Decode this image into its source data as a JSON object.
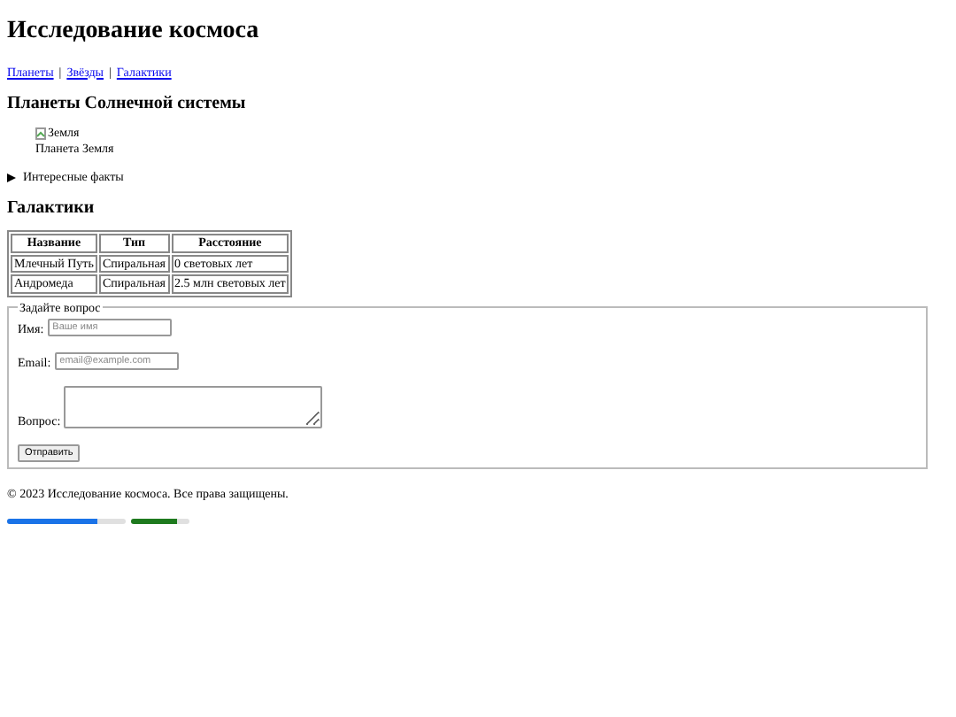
{
  "title": "Исследование космоса",
  "nav": [
    "Планеты",
    "Звёзды",
    "Галактики"
  ],
  "nav_separator": "|",
  "planets": {
    "heading": "Планеты Солнечной системы",
    "image_alt": "Земля",
    "caption": "Планета Земля"
  },
  "details": {
    "summary": "Интересные факты",
    "expanded": false
  },
  "galaxies": {
    "heading": "Галактики",
    "columns": [
      "Название",
      "Тип",
      "Расстояние"
    ],
    "rows": [
      [
        "Млечный Путь",
        "Спиральная",
        "0 световых лет"
      ],
      [
        "Андромеда",
        "Спиральная",
        "2.5 млн световых лет"
      ]
    ]
  },
  "form": {
    "legend": "Задайте вопрос",
    "fields": [
      {
        "kind": "input",
        "label": "Имя:",
        "placeholder": "Ваше имя"
      },
      {
        "kind": "input",
        "label": "Email:",
        "placeholder": "email@example.com"
      },
      {
        "kind": "textarea",
        "label": "Вопрос:"
      }
    ],
    "submit": "Отправить"
  },
  "footer": "© 2023 Исследование космоса. Все права защищены.",
  "bars": [
    {
      "kind": "progress",
      "level": 0.76
    },
    {
      "kind": "meter",
      "level": 0.8
    }
  ]
}
